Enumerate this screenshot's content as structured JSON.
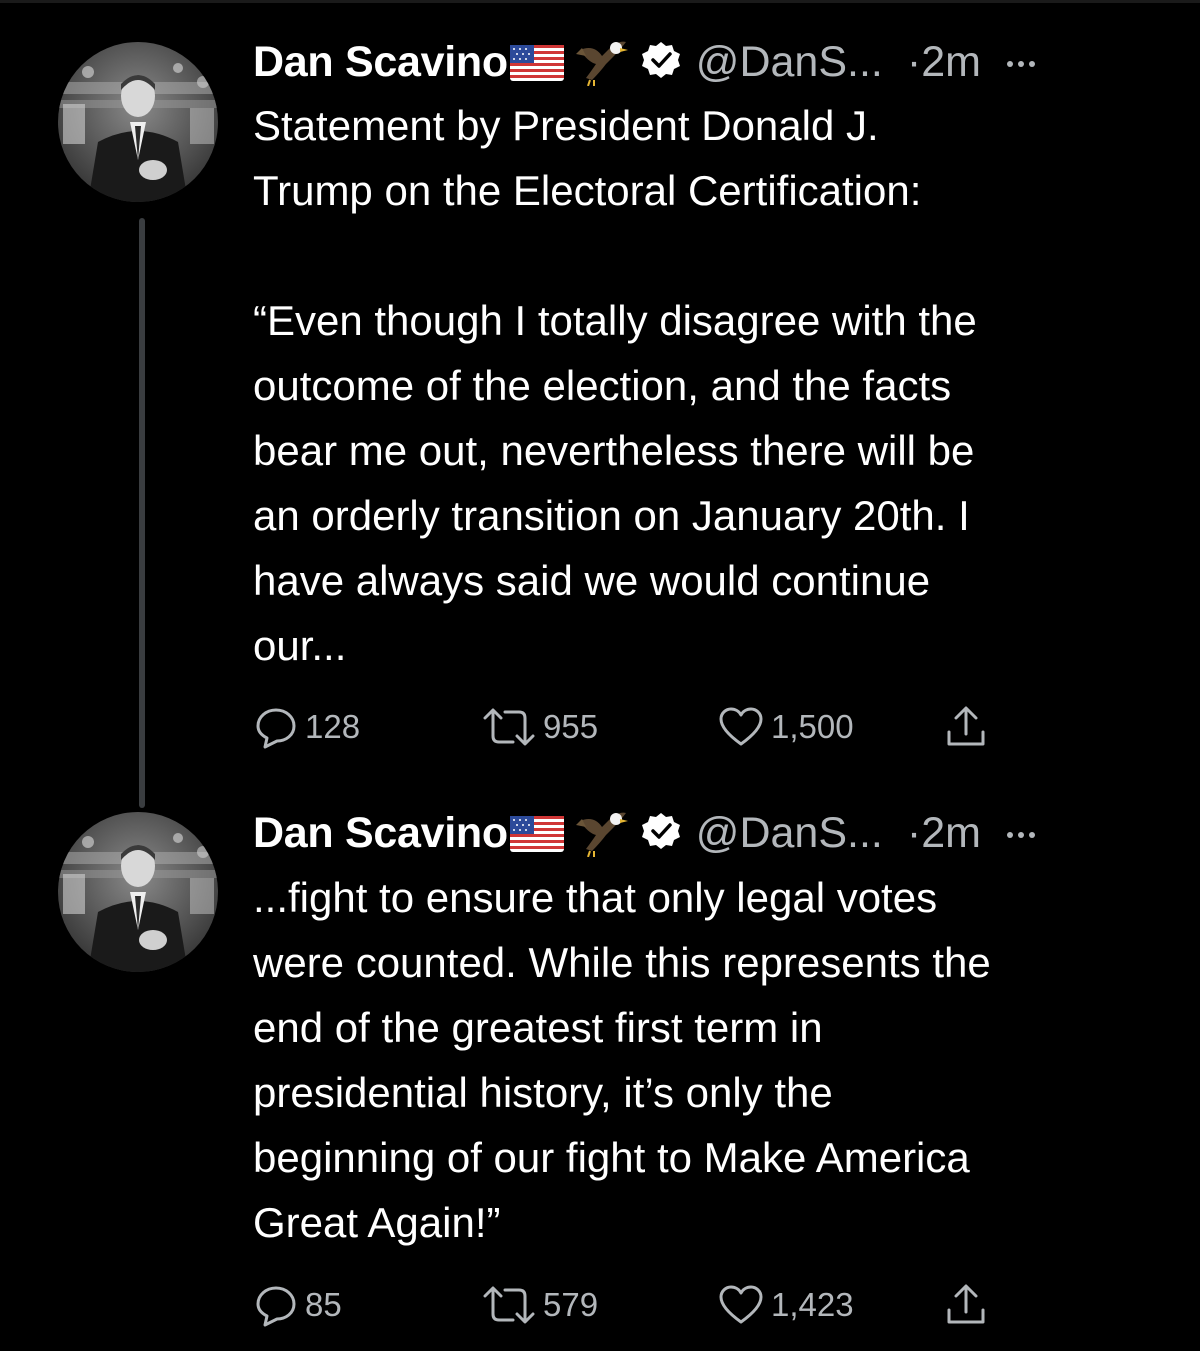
{
  "tweets": [
    {
      "author": {
        "name": "Dan Scavino",
        "handle": "@DanS...",
        "verified": true,
        "badges": [
          "us-flag-icon",
          "eagle-icon",
          "verified-icon"
        ]
      },
      "separator": "·",
      "time": "2m",
      "text_lines": [
        "Statement by President Donald J.",
        "Trump on the Electoral Certification:",
        "",
        "“Even though I totally disagree with the",
        "outcome of the election, and the facts",
        "bear me out, nevertheless there will be",
        "an orderly transition on January 20th. I",
        "have always said we would continue",
        "our..."
      ],
      "counts": {
        "replies": "128",
        "retweets": "955",
        "likes": "1,500"
      }
    },
    {
      "author": {
        "name": "Dan Scavino",
        "handle": "@DanS...",
        "verified": true,
        "badges": [
          "us-flag-icon",
          "eagle-icon",
          "verified-icon"
        ]
      },
      "separator": "·",
      "time": "2m",
      "text_lines": [
        "...fight to ensure that only legal votes",
        "were counted. While this represents the",
        "end of the greatest first term in",
        "presidential history, it’s only the",
        "beginning of our fight to Make America",
        "Great Again!”"
      ],
      "counts": {
        "replies": "85",
        "retweets": "579",
        "likes": "1,423"
      }
    }
  ],
  "theme": {
    "background": "#000000",
    "text": "#ffffff",
    "secondary_text": "#b3b7bb",
    "thread_line": "#3a3d40"
  }
}
